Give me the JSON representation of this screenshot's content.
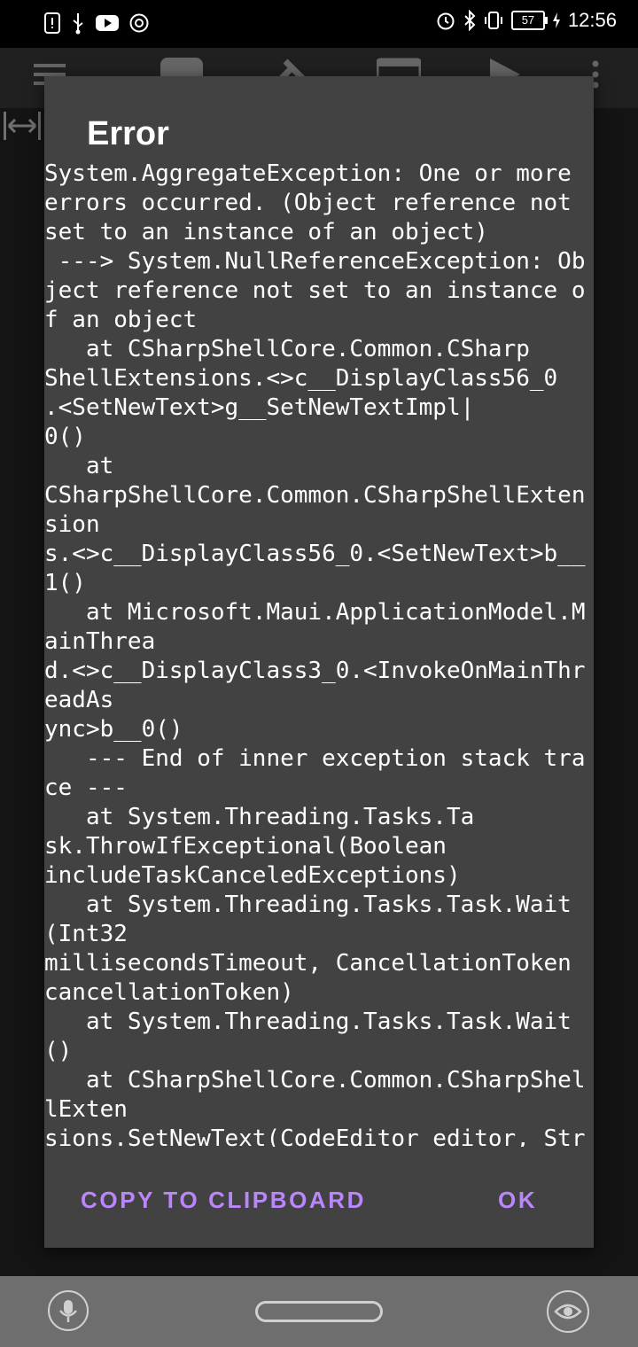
{
  "status_bar": {
    "time": "12:56",
    "battery": "57",
    "left_icons": [
      "notification-alert-icon",
      "usb-icon",
      "youtube-icon",
      "chrome-icon"
    ],
    "right_icons": [
      "alarm-icon",
      "bluetooth-icon",
      "vibrate-icon",
      "battery-icon",
      "charging-icon"
    ]
  },
  "dialog": {
    "title": "Error",
    "message": "System.AggregateException: One or more errors occurred. (Object reference not set to an instance of an object)\n ---> System.NullReferenceException: Object reference not set to an instance of an object\n   at CSharpShellCore.Common.CSharp\nShellExtensions.<>c__DisplayClass56_0\n.<SetNewText>g__SetNewTextImpl|\n0()\n   at\nCSharpShellCore.Common.CSharpShellExtension\ns.<>c__DisplayClass56_0.<SetNewText>b__1()\n   at Microsoft.Maui.ApplicationModel.MainThrea\nd.<>c__DisplayClass3_0.<InvokeOnMainThreadAs\nync>b__0()\n   --- End of inner exception stack trace ---\n   at System.Threading.Tasks.Ta\nsk.ThrowIfExceptional(Boolean\nincludeTaskCanceledExceptions)\n   at System.Threading.Tasks.Task.Wait(Int32\nmillisecondsTimeout, CancellationToken\ncancellationToken)\n   at System.Threading.Tasks.Task.Wait()\n   at CSharpShellCore.Common.CSharpShellExten\nsions.SetNewText(CodeEditor editor, String text,\nBoolean clearUndoStack)\n   at CSharpShellCore.Activities.MainActivity.Proj\n_SourceFilesDataLoaded(Object sender, List`1\ne)\n   at CSharpShellCore.IDE.CSharpProj\nect.LoadXml(Boolean isVb, String\nxml)\n   at CSharpShellCore.IDE.CSharpProject.Load()\n   at CSharpShellCore.IDE.Workspace.Init(IProject",
    "copy_button": "COPY TO CLIPBOARD",
    "ok_button": "OK"
  },
  "colors": {
    "dialog_bg": "#424242",
    "accent": "#bb86fc",
    "navbar_bg": "#6e6e6e"
  }
}
